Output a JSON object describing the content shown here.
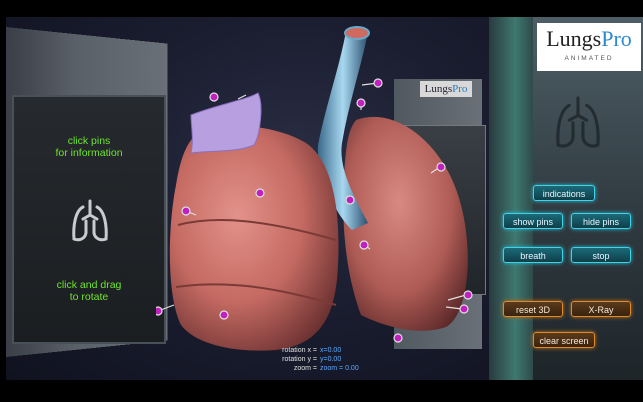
{
  "app": {
    "brand_lungs": "Lungs",
    "brand_pro": "Pro",
    "brand_sub": "ANIMATED"
  },
  "stage": {
    "hint_top": [
      "click pins",
      "for information"
    ],
    "hint_bottom": [
      "click and drag",
      "to rotate"
    ],
    "mini_logo_lungs": "Lungs",
    "mini_logo_pro": "Pro"
  },
  "readout": {
    "rotation_x_label": "rotation x  =",
    "rotation_x_value": "x=0.00",
    "rotation_y_label": "rotation y  =",
    "rotation_y_value": "y=0.00",
    "zoom_label": "zoom  =",
    "zoom_value": "zoom = 0.00"
  },
  "buttons": {
    "indications": "indications",
    "show_pins": "show pins",
    "hide_pins": "hide pins",
    "breath": "breath",
    "stop": "stop",
    "reset_3d": "reset 3D",
    "xray": "X-Ray",
    "clear_screen": "clear screen"
  },
  "colors": {
    "teal_accent": "#3fd3e8",
    "orange_accent": "#e08a2a",
    "hint_green": "#6ee62c",
    "readout_value_blue": "#5aa8ff",
    "pin_magenta": "#c020c0"
  }
}
